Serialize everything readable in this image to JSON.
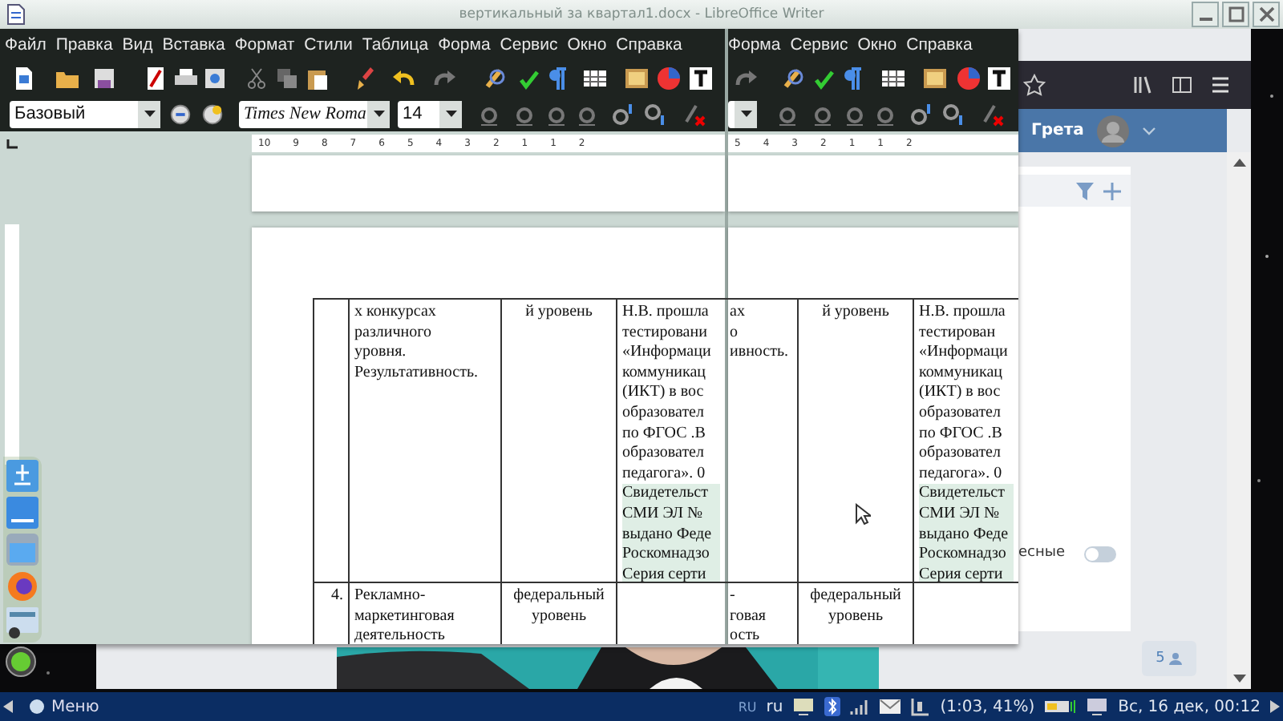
{
  "window": {
    "title": "вертикальный за квартал1.docx - LibreOffice Writer"
  },
  "menu": [
    {
      "label": "Файл"
    },
    {
      "label": "Правка"
    },
    {
      "label": "Вид"
    },
    {
      "label": "Вставка"
    },
    {
      "label": "Формат"
    },
    {
      "label": "Стили"
    },
    {
      "label": "Таблица"
    },
    {
      "label": "Форма"
    },
    {
      "label": "Сервис"
    },
    {
      "label": "Окно"
    },
    {
      "label": "Справка"
    }
  ],
  "format_bar": {
    "paragraph_style": "Базовый",
    "font_name": "Times New Roma",
    "font_size": "14"
  },
  "ruler": {
    "labels": [
      "10",
      "9",
      "8",
      "7",
      "6",
      "5",
      "4",
      "3",
      "2",
      "1",
      "1",
      "2"
    ]
  },
  "table": {
    "rows": [
      {
        "number": "",
        "topic": [
          "х конкурсах",
          "различного",
          "уровня.",
          "Результативность."
        ],
        "level": [
          "й уровень"
        ],
        "details": [
          {
            "text": "Н.В. прошла",
            "shaded": false
          },
          {
            "text": "тестировани",
            "shaded": false
          },
          {
            "text": "«Информаци",
            "shaded": false
          },
          {
            "text": "коммуникац",
            "shaded": false
          },
          {
            "text": "(ИКТ) в вос",
            "shaded": false
          },
          {
            "text": "образовател",
            "shaded": false
          },
          {
            "text": "по ФГОС .В",
            "shaded": false
          },
          {
            "text": "образовател",
            "shaded": false
          },
          {
            "text": "педагога». 0",
            "shaded": false
          },
          {
            "text": "Свидетельст",
            "shaded": true
          },
          {
            "text": "СМИ ЭЛ №",
            "shaded": true
          },
          {
            "text": "выдано Феде",
            "shaded": true
          },
          {
            "text": "Роскомнадзо",
            "shaded": true
          },
          {
            "text": "Серия серти",
            "shaded": true
          }
        ]
      },
      {
        "number": "4.",
        "topic": [
          "Рекламно-",
          "маркетинговая",
          "деятельность"
        ],
        "level": [
          "федеральный",
          "уровень"
        ],
        "details": []
      }
    ]
  },
  "overlay_strip": {
    "menu": [
      {
        "label": "Форма"
      },
      {
        "label": "Сервис"
      },
      {
        "label": "Окно"
      },
      {
        "label": "Справка"
      }
    ],
    "ruler_labels": [
      "5",
      "4",
      "3",
      "2",
      "1",
      "1",
      "2"
    ],
    "rows": [
      {
        "topic": [
          "ах",
          "о",
          "ивность."
        ],
        "level": [
          "й уровень"
        ],
        "details": [
          {
            "text": "Н.В. прошла",
            "shaded": false
          },
          {
            "text": "тестирован",
            "shaded": false
          },
          {
            "text": "«Информаци",
            "shaded": false
          },
          {
            "text": "коммуникац",
            "shaded": false
          },
          {
            "text": "(ИКТ) в вос",
            "shaded": false
          },
          {
            "text": "образовател",
            "shaded": false
          },
          {
            "text": "по ФГОС .В",
            "shaded": false
          },
          {
            "text": "образовател",
            "shaded": false
          },
          {
            "text": "педагога». 0",
            "shaded": false
          },
          {
            "text": "Свидетельст",
            "shaded": true
          },
          {
            "text": "СМИ ЭЛ №",
            "shaded": true
          },
          {
            "text": "выдано Феде",
            "shaded": true
          },
          {
            "text": "Роскомнадзо",
            "shaded": true
          },
          {
            "text": "Серия серти",
            "shaded": true
          }
        ]
      },
      {
        "topic": [
          "-",
          "говая",
          "ость"
        ],
        "level": [
          "федеральный",
          "уровень"
        ],
        "details": []
      }
    ]
  },
  "browser": {
    "user": "Грета",
    "toggle_label": "есные",
    "toggle_on": false,
    "count": "5"
  },
  "taskbar": {
    "menu": "Меню",
    "keyboard_indicator": "RU",
    "language": "ru",
    "battery": "(1:03, 41%)",
    "clock": "Вс, 16 дек, 00:12"
  }
}
